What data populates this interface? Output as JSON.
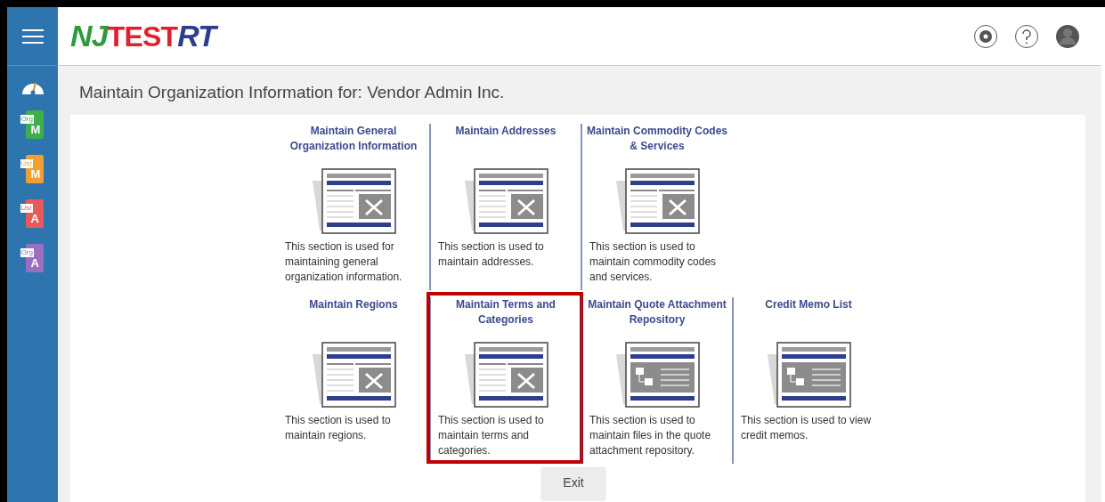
{
  "logo": {
    "left": "NJ",
    "overlay": "TEST",
    "right": "RT"
  },
  "sidebar": {
    "items": [
      {
        "kind": "dashboard"
      },
      {
        "kind": "doc",
        "tag": "Org",
        "letter": "M",
        "color": "#3fae49"
      },
      {
        "kind": "doc",
        "tag": "Usr",
        "letter": "M",
        "color": "#f0a030"
      },
      {
        "kind": "doc",
        "tag": "Usr",
        "letter": "A",
        "color": "#e85a5a"
      },
      {
        "kind": "doc",
        "tag": "Org",
        "letter": "A",
        "color": "#9b6fc0"
      }
    ]
  },
  "page_title": "Maintain Organization Information for: Vendor Admin Inc.",
  "rows": [
    [
      {
        "title": "Maintain General Organization Information",
        "kind": "tools",
        "description": "This section is used for maintaining general organization information.",
        "highlighted": false
      },
      {
        "title": "Maintain Addresses",
        "kind": "tools",
        "description": "This section is used to maintain addresses.",
        "highlighted": false
      },
      {
        "title": "Maintain Commodity Codes & Services",
        "kind": "tools",
        "description": "This section is used to maintain commodity codes and services.",
        "highlighted": false
      }
    ],
    [
      {
        "title": "Maintain Regions",
        "kind": "tools",
        "description": "This section is used to maintain regions.",
        "highlighted": false
      },
      {
        "title": "Maintain Terms and Categories",
        "kind": "tools",
        "description": "This section is used to maintain terms and categories.",
        "highlighted": true
      },
      {
        "title": "Maintain Quote Attachment Repository",
        "kind": "files",
        "description": "This section is used to maintain files in the quote attachment repository.",
        "highlighted": false
      },
      {
        "title": "Credit Memo List",
        "kind": "files",
        "description": "This section is used to view credit memos.",
        "highlighted": false
      }
    ]
  ],
  "exit_button": "Exit"
}
